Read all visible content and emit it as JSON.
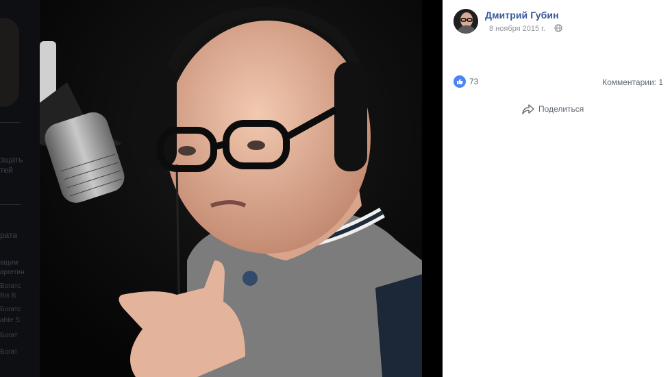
{
  "post": {
    "author": "Дмитрий Губин",
    "date": "8 ноября 2015 г.",
    "privacy_icon": "globe-icon",
    "likes": "73",
    "comments": "Комментарии: 1",
    "share_label": "Поделиться"
  },
  "background_page": {
    "snippets": [
      "зщать",
      "тей",
      "рата",
      "ащим",
      "аргетин",
      "Богатс",
      "Bis B",
      "Богатс",
      "ahte S",
      "Богат",
      "Богат"
    ]
  },
  "colors": {
    "author_link": "#385898",
    "like_blue": "#4c84f3",
    "meta_gray": "#90949c"
  }
}
